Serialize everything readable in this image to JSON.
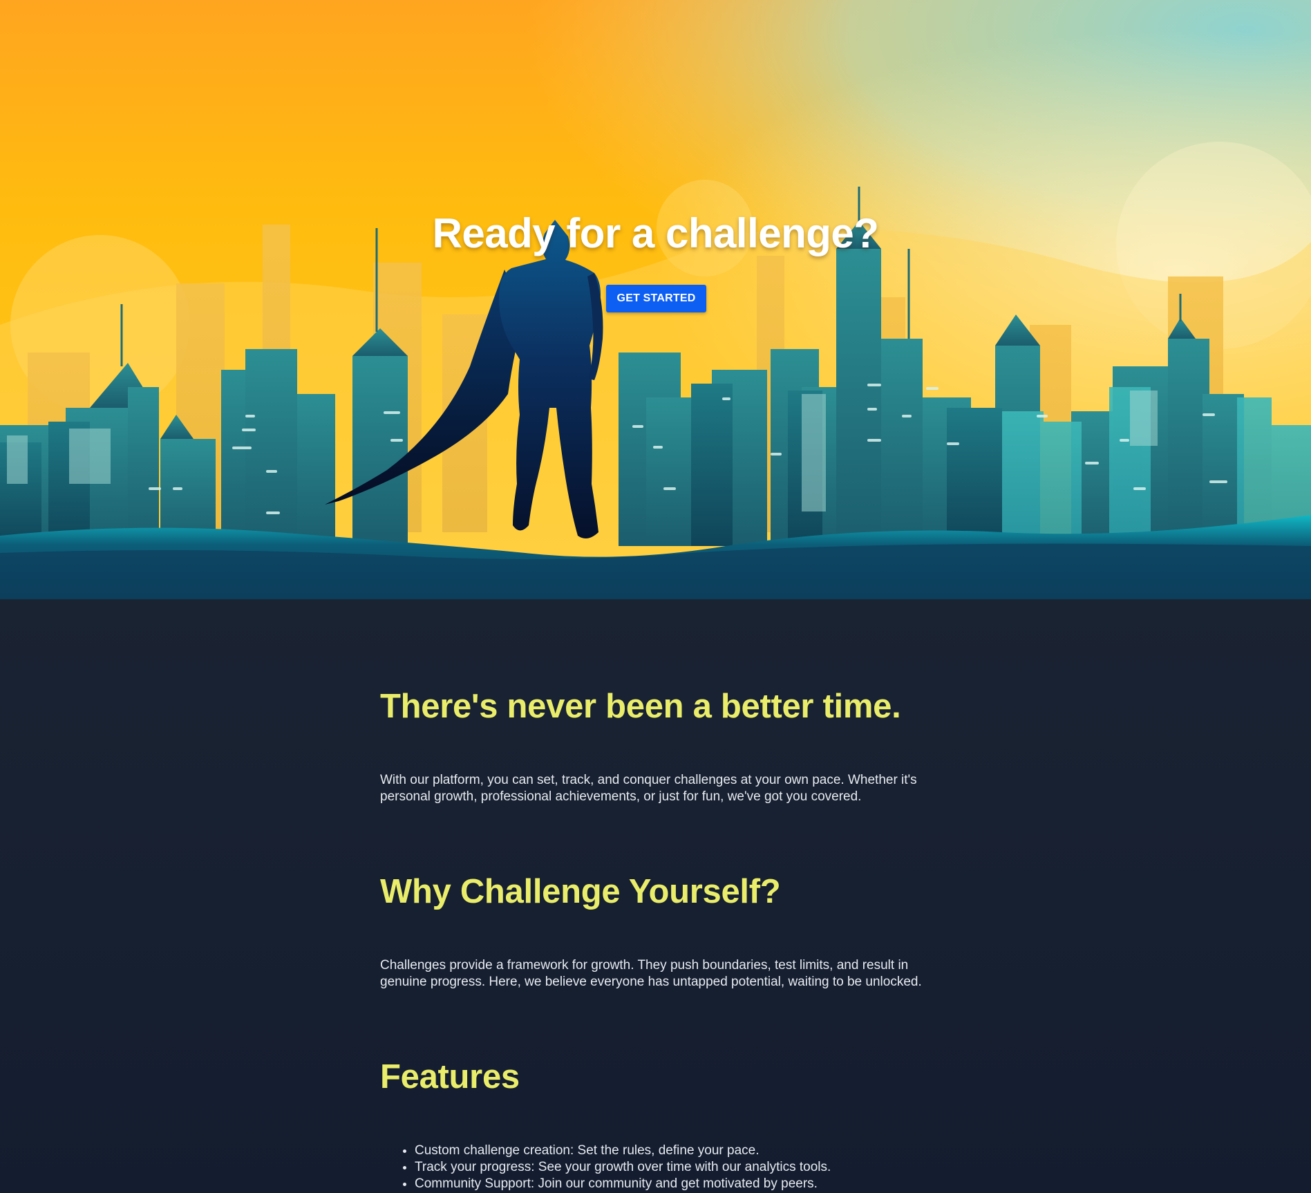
{
  "hero": {
    "title": "Ready for a challenge?",
    "cta_label": "GET STARTED"
  },
  "sections": [
    {
      "heading": "There's never been a better time.",
      "text": "With our platform, you can set, track, and conquer challenges at your own pace. Whether it's personal growth, professional achievements, or just for fun, we've got you covered."
    },
    {
      "heading": "Why Challenge Yourself?",
      "text": "Challenges provide a framework for growth. They push boundaries, test limits, and result in genuine progress. Here, we believe everyone has untapped potential, waiting to be unlocked."
    },
    {
      "heading": "Features",
      "items": [
        "Custom challenge creation: Set the rules, define your pace.",
        "Track your progress: See your growth over time with our analytics tools.",
        "Community Support: Join our community and get motivated by peers."
      ]
    }
  ],
  "colors": {
    "background": "#172033",
    "heading": "#eaed6a",
    "body_text": "#e7ebf1",
    "button": "#0d5ff4",
    "sky_orange": "#ffb300",
    "sky_teal": "#8fd3cf",
    "city_teal": "#1f6e7a",
    "hero_silhouette": "#0a1a3a"
  },
  "icons": {
    "hero_image": "superhero-cityscape-illustration",
    "list_bullet": "disc-bullet"
  }
}
